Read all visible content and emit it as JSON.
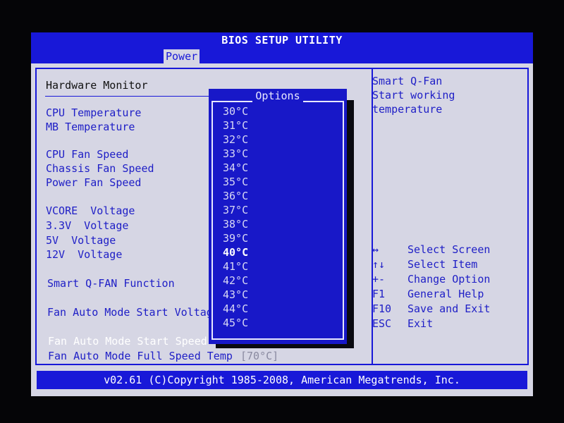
{
  "title": "BIOS SETUP UTILITY",
  "tab": "Power",
  "section_header": "Hardware Monitor",
  "items": [
    {
      "label": "CPU Temperature"
    },
    {
      "label": "MB Temperature"
    },
    {
      "label": "CPU Fan Speed"
    },
    {
      "label": "Chassis Fan Speed"
    },
    {
      "label": "Power Fan Speed"
    },
    {
      "label": "VCORE  Voltage"
    },
    {
      "label": "3.3V  Voltage"
    },
    {
      "label": "5V  Voltage"
    },
    {
      "label": "12V  Voltage"
    },
    {
      "label": "Smart Q-FAN Function"
    },
    {
      "label": "Fan Auto Mode Start Voltage"
    },
    {
      "label": "Fan Auto Mode Start Speed T"
    },
    {
      "label": "Fan Auto Mode Full Speed Temp",
      "value": "[70°C]"
    }
  ],
  "help_text": [
    "Smart Q-Fan",
    "Start working",
    "temperature"
  ],
  "keys": [
    {
      "key": "↔",
      "desc": "Select Screen",
      "icon": "left-right-arrow-icon"
    },
    {
      "key": "↑↓",
      "desc": "Select Item",
      "icon": "up-down-arrow-icon"
    },
    {
      "key": "+-",
      "desc": "Change Option"
    },
    {
      "key": "F1",
      "desc": "General Help"
    },
    {
      "key": "F10",
      "desc": "Save and Exit"
    },
    {
      "key": "ESC",
      "desc": "Exit"
    }
  ],
  "popup": {
    "title": "Options",
    "options": [
      "30°C",
      "31°C",
      "32°C",
      "33°C",
      "34°C",
      "35°C",
      "36°C",
      "37°C",
      "38°C",
      "39°C",
      "40°C",
      "41°C",
      "42°C",
      "43°C",
      "44°C",
      "45°C"
    ],
    "selected": "40°C"
  },
  "footer": "v02.61 (C)Copyright 1985-2008, American Megatrends, Inc.",
  "colors": {
    "bios_blue": "#1818d8",
    "panel_grey": "#d6d6e4",
    "text_blue": "#1e1ec6"
  }
}
